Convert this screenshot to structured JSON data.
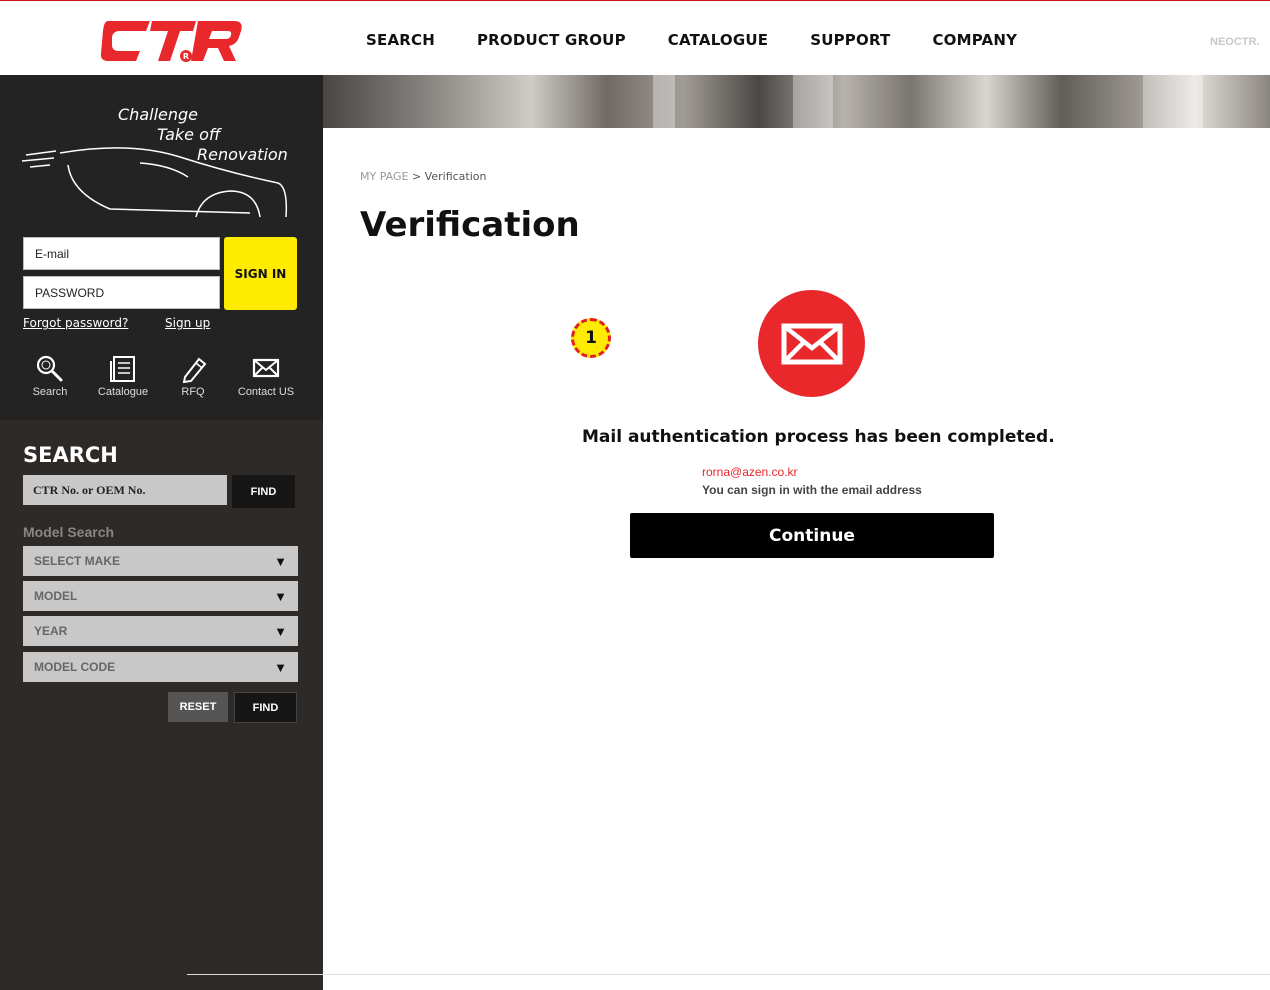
{
  "header": {
    "brand": "CTR",
    "nav": [
      "SEARCH",
      "PRODUCT GROUP",
      "CATALOGUE",
      "SUPPORT",
      "COMPANY"
    ],
    "right_text": "NEOCTR."
  },
  "sidebar": {
    "slogan": [
      "Challenge",
      "Take off",
      "Renovation"
    ],
    "login": {
      "email_placeholder": "E-mail",
      "password_placeholder": "PASSWORD",
      "signin_label": "SIGN IN",
      "forgot_label": "Forgot password?",
      "signup_label": "Sign up"
    },
    "quick_links": [
      {
        "label": "Search",
        "icon": "search-icon"
      },
      {
        "label": "Catalogue",
        "icon": "catalogue-icon"
      },
      {
        "label": "RFQ",
        "icon": "pencil-icon"
      },
      {
        "label": "Contact US",
        "icon": "mail-icon"
      }
    ],
    "search": {
      "title": "SEARCH",
      "input_placeholder": "CTR No. or OEM No.",
      "find_label": "FIND",
      "model_search_title": "Model Search",
      "selects": [
        "SELECT MAKE",
        "MODEL",
        "YEAR",
        "MODEL CODE"
      ],
      "reset_label": "RESET",
      "find2_label": "FIND"
    }
  },
  "main": {
    "breadcrumb_link": "MY PAGE",
    "breadcrumb_sep": ">",
    "breadcrumb_current": "Verification",
    "title": "Verification",
    "marker": "1",
    "message": "Mail authentication process has been completed.",
    "email": "rorna@azen.co.kr",
    "hint": "You can sign in with the email address",
    "continue_label": "Continue"
  },
  "colors": {
    "accent_red": "#e8282b",
    "signin_yellow": "#ffeb00",
    "sidebar_dark": "#232323"
  }
}
